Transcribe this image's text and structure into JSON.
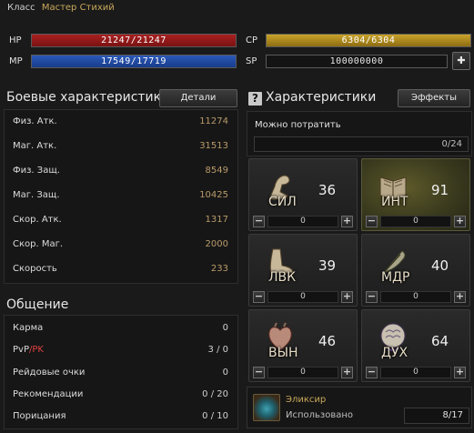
{
  "header": {
    "class_label": "Класс",
    "class_value": "Мастер Стихий"
  },
  "bars": {
    "hp": {
      "label": "HP",
      "value": "21247/21247",
      "fraction": 1.0
    },
    "mp": {
      "label": "MP",
      "value": "17549/17719",
      "fraction": 0.99
    },
    "cp": {
      "label": "CP",
      "value": "6304/6304",
      "fraction": 1.0
    },
    "sp": {
      "label": "SP",
      "value": "100000000"
    }
  },
  "combat": {
    "title": "Боевые характеристики",
    "details_button": "Детали",
    "rows": [
      {
        "label": "Физ. Атк.",
        "value": "11274"
      },
      {
        "label": "Маг. Атк.",
        "value": "31513"
      },
      {
        "label": "Физ. Защ.",
        "value": "8549"
      },
      {
        "label": "Маг. Защ.",
        "value": "10425"
      },
      {
        "label": "Скор. Атк.",
        "value": "1317"
      },
      {
        "label": "Скор. Маг.",
        "value": "2000"
      },
      {
        "label": "Скорость",
        "value": "233"
      }
    ]
  },
  "social": {
    "title": "Общение",
    "rows": [
      {
        "label": "Карма",
        "value": "0"
      },
      {
        "label_pvp": "PvP",
        "label_sep": "/",
        "label_pk": "PK",
        "value": "3 / 0"
      },
      {
        "label": "Рейдовые очки",
        "value": "0"
      },
      {
        "label": "Рекомендации",
        "value": "0 / 20"
      },
      {
        "label": "Порицания",
        "value": "0 / 10"
      }
    ]
  },
  "attributes": {
    "help_icon": "?",
    "title": "Характеристики",
    "effects_button": "Эффекты",
    "available_label": "Можно потратить",
    "available_value": "0/24",
    "stats": [
      {
        "abbr": "СИЛ",
        "value": "36",
        "alloc": "0",
        "icon": "arm-icon",
        "active": false
      },
      {
        "abbr": "ИНТ",
        "value": "91",
        "alloc": "0",
        "icon": "book-icon",
        "active": true
      },
      {
        "abbr": "ЛВК",
        "value": "39",
        "alloc": "0",
        "icon": "foot-icon",
        "active": false
      },
      {
        "abbr": "МДР",
        "value": "40",
        "alloc": "0",
        "icon": "feather-icon",
        "active": false
      },
      {
        "abbr": "ВЫН",
        "value": "46",
        "alloc": "0",
        "icon": "heart-icon",
        "active": false
      },
      {
        "abbr": "ДУХ",
        "value": "64",
        "alloc": "0",
        "icon": "brain-icon",
        "active": false
      }
    ],
    "minus": "−",
    "plus": "+"
  },
  "elixir": {
    "name": "Эликсир",
    "used_label": "Использовано",
    "count": "8/17"
  },
  "colors": {
    "accent_gold": "#c9a95a",
    "hp": "#a82020",
    "mp": "#2a58b8",
    "cp": "#c9a22a"
  }
}
